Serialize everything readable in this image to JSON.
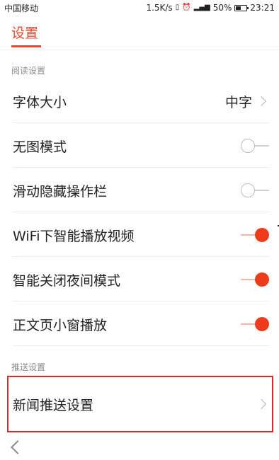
{
  "status_bar": {
    "carrier": "中国移动",
    "speed": "1.5K/s",
    "battery_percent": "50%",
    "time": "23:21",
    "battery_level": 0.5
  },
  "header": {
    "tab_label": "设置"
  },
  "reading_section": {
    "title": "阅读设置",
    "items": [
      {
        "label": "字体大小",
        "value": "中字",
        "type": "link"
      },
      {
        "label": "无图模式",
        "type": "toggle",
        "on": false
      },
      {
        "label": "滑动隐藏操作栏",
        "type": "toggle",
        "on": false
      },
      {
        "label": "WiFi下智能播放视频",
        "type": "toggle",
        "on": true
      },
      {
        "label": "智能关闭夜间模式",
        "type": "toggle",
        "on": true
      },
      {
        "label": "正文页小窗播放",
        "type": "toggle",
        "on": true
      }
    ]
  },
  "push_section": {
    "title": "推送设置",
    "items": [
      {
        "label": "新闻推送设置",
        "type": "link"
      }
    ]
  },
  "colors": {
    "accent": "#e8462c",
    "toggle_on": "#ee3b1c",
    "highlight": "#d92b2b"
  }
}
